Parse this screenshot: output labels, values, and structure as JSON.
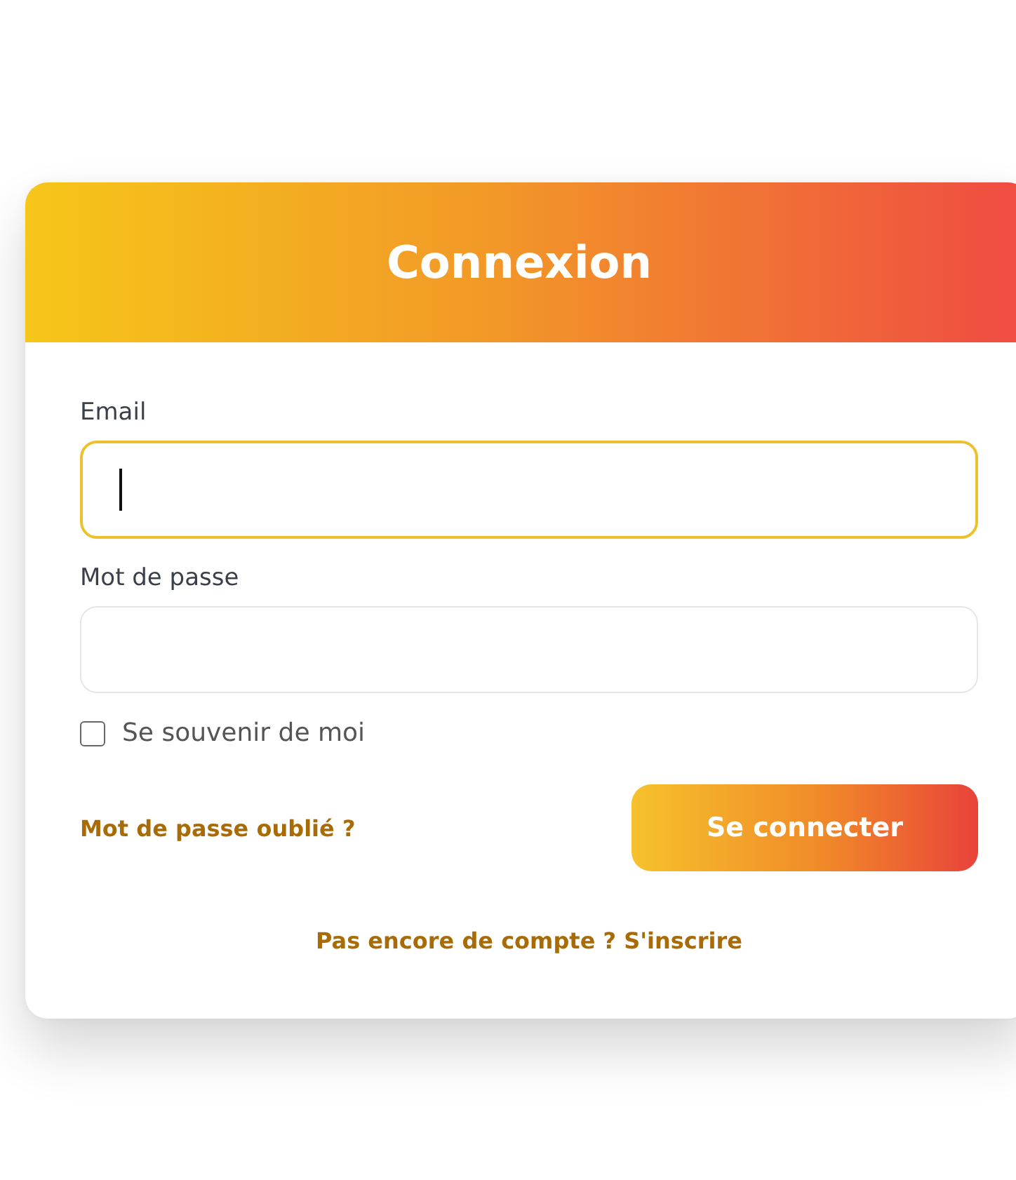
{
  "card": {
    "title": "Connexion"
  },
  "fields": [
    {
      "label": "Email",
      "focused": true
    },
    {
      "label": "Mot de passe",
      "focused": false
    }
  ],
  "remember": {
    "label": "Se souvenir de moi",
    "checked": false
  },
  "forgot_link": "Mot de passe oublié ?",
  "submit_button": "Se connecter",
  "signup_link": "Pas encore de compte ? S'inscrire"
}
